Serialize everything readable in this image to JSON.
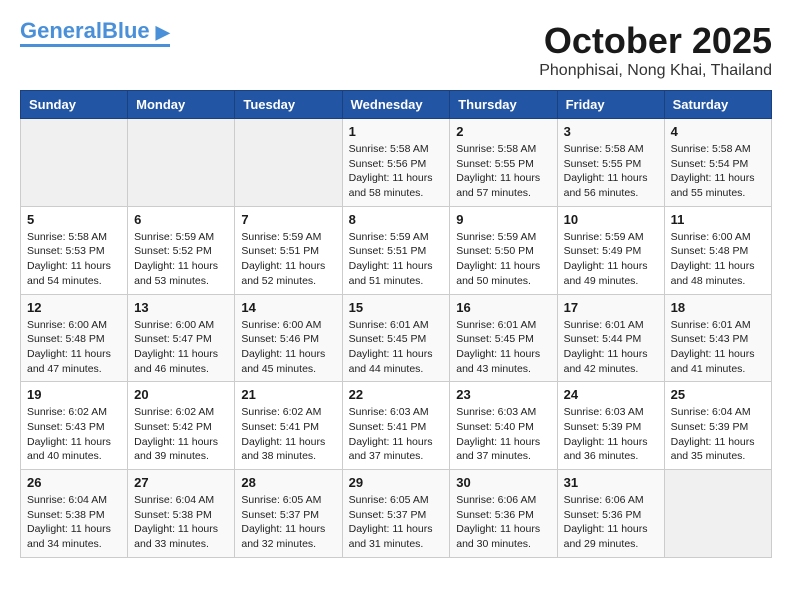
{
  "header": {
    "logo_general": "General",
    "logo_blue": "Blue",
    "month_title": "October 2025",
    "location": "Phonphisai, Nong Khai, Thailand"
  },
  "weekdays": [
    "Sunday",
    "Monday",
    "Tuesday",
    "Wednesday",
    "Thursday",
    "Friday",
    "Saturday"
  ],
  "weeks": [
    [
      {
        "day": "",
        "info": ""
      },
      {
        "day": "",
        "info": ""
      },
      {
        "day": "",
        "info": ""
      },
      {
        "day": "1",
        "info": "Sunrise: 5:58 AM\nSunset: 5:56 PM\nDaylight: 11 hours\nand 58 minutes."
      },
      {
        "day": "2",
        "info": "Sunrise: 5:58 AM\nSunset: 5:55 PM\nDaylight: 11 hours\nand 57 minutes."
      },
      {
        "day": "3",
        "info": "Sunrise: 5:58 AM\nSunset: 5:55 PM\nDaylight: 11 hours\nand 56 minutes."
      },
      {
        "day": "4",
        "info": "Sunrise: 5:58 AM\nSunset: 5:54 PM\nDaylight: 11 hours\nand 55 minutes."
      }
    ],
    [
      {
        "day": "5",
        "info": "Sunrise: 5:58 AM\nSunset: 5:53 PM\nDaylight: 11 hours\nand 54 minutes."
      },
      {
        "day": "6",
        "info": "Sunrise: 5:59 AM\nSunset: 5:52 PM\nDaylight: 11 hours\nand 53 minutes."
      },
      {
        "day": "7",
        "info": "Sunrise: 5:59 AM\nSunset: 5:51 PM\nDaylight: 11 hours\nand 52 minutes."
      },
      {
        "day": "8",
        "info": "Sunrise: 5:59 AM\nSunset: 5:51 PM\nDaylight: 11 hours\nand 51 minutes."
      },
      {
        "day": "9",
        "info": "Sunrise: 5:59 AM\nSunset: 5:50 PM\nDaylight: 11 hours\nand 50 minutes."
      },
      {
        "day": "10",
        "info": "Sunrise: 5:59 AM\nSunset: 5:49 PM\nDaylight: 11 hours\nand 49 minutes."
      },
      {
        "day": "11",
        "info": "Sunrise: 6:00 AM\nSunset: 5:48 PM\nDaylight: 11 hours\nand 48 minutes."
      }
    ],
    [
      {
        "day": "12",
        "info": "Sunrise: 6:00 AM\nSunset: 5:48 PM\nDaylight: 11 hours\nand 47 minutes."
      },
      {
        "day": "13",
        "info": "Sunrise: 6:00 AM\nSunset: 5:47 PM\nDaylight: 11 hours\nand 46 minutes."
      },
      {
        "day": "14",
        "info": "Sunrise: 6:00 AM\nSunset: 5:46 PM\nDaylight: 11 hours\nand 45 minutes."
      },
      {
        "day": "15",
        "info": "Sunrise: 6:01 AM\nSunset: 5:45 PM\nDaylight: 11 hours\nand 44 minutes."
      },
      {
        "day": "16",
        "info": "Sunrise: 6:01 AM\nSunset: 5:45 PM\nDaylight: 11 hours\nand 43 minutes."
      },
      {
        "day": "17",
        "info": "Sunrise: 6:01 AM\nSunset: 5:44 PM\nDaylight: 11 hours\nand 42 minutes."
      },
      {
        "day": "18",
        "info": "Sunrise: 6:01 AM\nSunset: 5:43 PM\nDaylight: 11 hours\nand 41 minutes."
      }
    ],
    [
      {
        "day": "19",
        "info": "Sunrise: 6:02 AM\nSunset: 5:43 PM\nDaylight: 11 hours\nand 40 minutes."
      },
      {
        "day": "20",
        "info": "Sunrise: 6:02 AM\nSunset: 5:42 PM\nDaylight: 11 hours\nand 39 minutes."
      },
      {
        "day": "21",
        "info": "Sunrise: 6:02 AM\nSunset: 5:41 PM\nDaylight: 11 hours\nand 38 minutes."
      },
      {
        "day": "22",
        "info": "Sunrise: 6:03 AM\nSunset: 5:41 PM\nDaylight: 11 hours\nand 37 minutes."
      },
      {
        "day": "23",
        "info": "Sunrise: 6:03 AM\nSunset: 5:40 PM\nDaylight: 11 hours\nand 37 minutes."
      },
      {
        "day": "24",
        "info": "Sunrise: 6:03 AM\nSunset: 5:39 PM\nDaylight: 11 hours\nand 36 minutes."
      },
      {
        "day": "25",
        "info": "Sunrise: 6:04 AM\nSunset: 5:39 PM\nDaylight: 11 hours\nand 35 minutes."
      }
    ],
    [
      {
        "day": "26",
        "info": "Sunrise: 6:04 AM\nSunset: 5:38 PM\nDaylight: 11 hours\nand 34 minutes."
      },
      {
        "day": "27",
        "info": "Sunrise: 6:04 AM\nSunset: 5:38 PM\nDaylight: 11 hours\nand 33 minutes."
      },
      {
        "day": "28",
        "info": "Sunrise: 6:05 AM\nSunset: 5:37 PM\nDaylight: 11 hours\nand 32 minutes."
      },
      {
        "day": "29",
        "info": "Sunrise: 6:05 AM\nSunset: 5:37 PM\nDaylight: 11 hours\nand 31 minutes."
      },
      {
        "day": "30",
        "info": "Sunrise: 6:06 AM\nSunset: 5:36 PM\nDaylight: 11 hours\nand 30 minutes."
      },
      {
        "day": "31",
        "info": "Sunrise: 6:06 AM\nSunset: 5:36 PM\nDaylight: 11 hours\nand 29 minutes."
      },
      {
        "day": "",
        "info": ""
      }
    ]
  ]
}
